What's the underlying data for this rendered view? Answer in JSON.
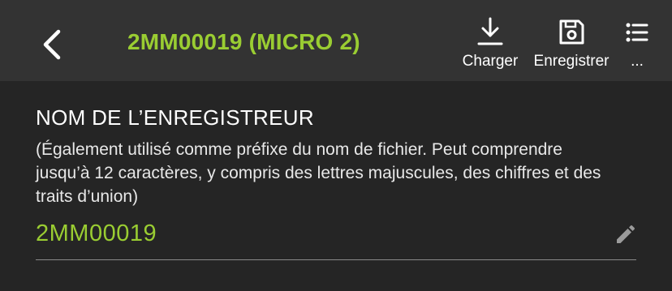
{
  "header": {
    "back_icon": "chevron-left-icon",
    "title": "2MM00019 (MICRO 2)",
    "title_color": "#9ACD32",
    "actions": [
      {
        "label": "Charger",
        "icon": "download-icon"
      },
      {
        "label": "Enregistrer",
        "icon": "save-icon"
      },
      {
        "label": "...",
        "icon": "list-icon"
      }
    ]
  },
  "section": {
    "title": "NOM DE L’ENREGISTREUR",
    "description": "(Également utilisé comme préfixe du nom de fichier.  Peut comprendre jusqu’à 12 caractères, y compris des lettres majuscules, des chiffres et des traits d’union)"
  },
  "field": {
    "value": "2MM00019",
    "value_color": "#9ACD32",
    "edit_icon": "pencil-icon"
  }
}
